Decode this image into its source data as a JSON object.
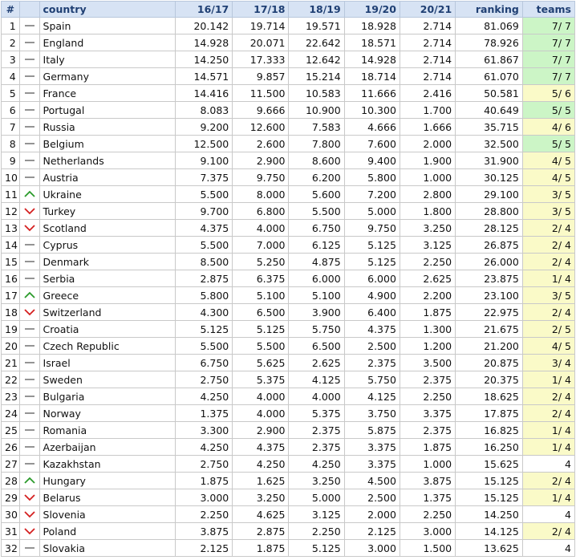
{
  "header": {
    "rank": "#",
    "country": "country",
    "seasons": [
      "16/17",
      "17/18",
      "18/19",
      "19/20",
      "20/21"
    ],
    "ranking": "ranking",
    "teams": "teams"
  },
  "colors": {
    "up": "#2a9a2a",
    "down": "#d42020",
    "same": "#888888",
    "teams_green": "#ccf5c6",
    "teams_yellow": "#fafac8"
  },
  "rows": [
    {
      "rank": "1",
      "trend": "same",
      "country": "Spain",
      "s": [
        "20.142",
        "19.714",
        "19.571",
        "18.928",
        "2.714"
      ],
      "ranking": "81.069",
      "teams": "7/ 7",
      "tc": "green"
    },
    {
      "rank": "2",
      "trend": "same",
      "country": "England",
      "s": [
        "14.928",
        "20.071",
        "22.642",
        "18.571",
        "2.714"
      ],
      "ranking": "78.926",
      "teams": "7/ 7",
      "tc": "green"
    },
    {
      "rank": "3",
      "trend": "same",
      "country": "Italy",
      "s": [
        "14.250",
        "17.333",
        "12.642",
        "14.928",
        "2.714"
      ],
      "ranking": "61.867",
      "teams": "7/ 7",
      "tc": "green"
    },
    {
      "rank": "4",
      "trend": "same",
      "country": "Germany",
      "s": [
        "14.571",
        "9.857",
        "15.214",
        "18.714",
        "2.714"
      ],
      "ranking": "61.070",
      "teams": "7/ 7",
      "tc": "green"
    },
    {
      "rank": "5",
      "trend": "same",
      "country": "France",
      "s": [
        "14.416",
        "11.500",
        "10.583",
        "11.666",
        "2.416"
      ],
      "ranking": "50.581",
      "teams": "5/ 6",
      "tc": "yellow"
    },
    {
      "rank": "6",
      "trend": "same",
      "country": "Portugal",
      "s": [
        "8.083",
        "9.666",
        "10.900",
        "10.300",
        "1.700"
      ],
      "ranking": "40.649",
      "teams": "5/ 5",
      "tc": "green"
    },
    {
      "rank": "7",
      "trend": "same",
      "country": "Russia",
      "s": [
        "9.200",
        "12.600",
        "7.583",
        "4.666",
        "1.666"
      ],
      "ranking": "35.715",
      "teams": "4/ 6",
      "tc": "yellow"
    },
    {
      "rank": "8",
      "trend": "same",
      "country": "Belgium",
      "s": [
        "12.500",
        "2.600",
        "7.800",
        "7.600",
        "2.000"
      ],
      "ranking": "32.500",
      "teams": "5/ 5",
      "tc": "green"
    },
    {
      "rank": "9",
      "trend": "same",
      "country": "Netherlands",
      "s": [
        "9.100",
        "2.900",
        "8.600",
        "9.400",
        "1.900"
      ],
      "ranking": "31.900",
      "teams": "4/ 5",
      "tc": "yellow"
    },
    {
      "rank": "10",
      "trend": "same",
      "country": "Austria",
      "s": [
        "7.375",
        "9.750",
        "6.200",
        "5.800",
        "1.000"
      ],
      "ranking": "30.125",
      "teams": "4/ 5",
      "tc": "yellow"
    },
    {
      "rank": "11",
      "trend": "up",
      "country": "Ukraine",
      "s": [
        "5.500",
        "8.000",
        "5.600",
        "7.200",
        "2.800"
      ],
      "ranking": "29.100",
      "teams": "3/ 5",
      "tc": "yellow"
    },
    {
      "rank": "12",
      "trend": "down",
      "country": "Turkey",
      "s": [
        "9.700",
        "6.800",
        "5.500",
        "5.000",
        "1.800"
      ],
      "ranking": "28.800",
      "teams": "3/ 5",
      "tc": "yellow"
    },
    {
      "rank": "13",
      "trend": "down",
      "country": "Scotland",
      "s": [
        "4.375",
        "4.000",
        "6.750",
        "9.750",
        "3.250"
      ],
      "ranking": "28.125",
      "teams": "2/ 4",
      "tc": "yellow"
    },
    {
      "rank": "14",
      "trend": "same",
      "country": "Cyprus",
      "s": [
        "5.500",
        "7.000",
        "6.125",
        "5.125",
        "3.125"
      ],
      "ranking": "26.875",
      "teams": "2/ 4",
      "tc": "yellow"
    },
    {
      "rank": "15",
      "trend": "same",
      "country": "Denmark",
      "s": [
        "8.500",
        "5.250",
        "4.875",
        "5.125",
        "2.250"
      ],
      "ranking": "26.000",
      "teams": "2/ 4",
      "tc": "yellow"
    },
    {
      "rank": "16",
      "trend": "same",
      "country": "Serbia",
      "s": [
        "2.875",
        "6.375",
        "6.000",
        "6.000",
        "2.625"
      ],
      "ranking": "23.875",
      "teams": "1/ 4",
      "tc": "yellow"
    },
    {
      "rank": "17",
      "trend": "up",
      "country": "Greece",
      "s": [
        "5.800",
        "5.100",
        "5.100",
        "4.900",
        "2.200"
      ],
      "ranking": "23.100",
      "teams": "3/ 5",
      "tc": "yellow"
    },
    {
      "rank": "18",
      "trend": "down",
      "country": "Switzerland",
      "s": [
        "4.300",
        "6.500",
        "3.900",
        "6.400",
        "1.875"
      ],
      "ranking": "22.975",
      "teams": "2/ 4",
      "tc": "yellow"
    },
    {
      "rank": "19",
      "trend": "same",
      "country": "Croatia",
      "s": [
        "5.125",
        "5.125",
        "5.750",
        "4.375",
        "1.300"
      ],
      "ranking": "21.675",
      "teams": "2/ 5",
      "tc": "yellow"
    },
    {
      "rank": "20",
      "trend": "same",
      "country": "Czech Republic",
      "s": [
        "5.500",
        "5.500",
        "6.500",
        "2.500",
        "1.200"
      ],
      "ranking": "21.200",
      "teams": "4/ 5",
      "tc": "yellow"
    },
    {
      "rank": "21",
      "trend": "same",
      "country": "Israel",
      "s": [
        "6.750",
        "5.625",
        "2.625",
        "2.375",
        "3.500"
      ],
      "ranking": "20.875",
      "teams": "3/ 4",
      "tc": "yellow"
    },
    {
      "rank": "22",
      "trend": "same",
      "country": "Sweden",
      "s": [
        "2.750",
        "5.375",
        "4.125",
        "5.750",
        "2.375"
      ],
      "ranking": "20.375",
      "teams": "1/ 4",
      "tc": "yellow"
    },
    {
      "rank": "23",
      "trend": "same",
      "country": "Bulgaria",
      "s": [
        "4.250",
        "4.000",
        "4.000",
        "4.125",
        "2.250"
      ],
      "ranking": "18.625",
      "teams": "2/ 4",
      "tc": "yellow"
    },
    {
      "rank": "24",
      "trend": "same",
      "country": "Norway",
      "s": [
        "1.375",
        "4.000",
        "5.375",
        "3.750",
        "3.375"
      ],
      "ranking": "17.875",
      "teams": "2/ 4",
      "tc": "yellow"
    },
    {
      "rank": "25",
      "trend": "same",
      "country": "Romania",
      "s": [
        "3.300",
        "2.900",
        "2.375",
        "5.875",
        "2.375"
      ],
      "ranking": "16.825",
      "teams": "1/ 4",
      "tc": "yellow"
    },
    {
      "rank": "26",
      "trend": "same",
      "country": "Azerbaijan",
      "s": [
        "4.250",
        "4.375",
        "2.375",
        "3.375",
        "1.875"
      ],
      "ranking": "16.250",
      "teams": "1/ 4",
      "tc": "yellow"
    },
    {
      "rank": "27",
      "trend": "same",
      "country": "Kazakhstan",
      "s": [
        "2.750",
        "4.250",
        "4.250",
        "3.375",
        "1.000"
      ],
      "ranking": "15.625",
      "teams": "4",
      "tc": "white"
    },
    {
      "rank": "28",
      "trend": "up",
      "country": "Hungary",
      "s": [
        "1.875",
        "1.625",
        "3.250",
        "4.500",
        "3.875"
      ],
      "ranking": "15.125",
      "teams": "2/ 4",
      "tc": "yellow"
    },
    {
      "rank": "29",
      "trend": "down",
      "country": "Belarus",
      "s": [
        "3.000",
        "3.250",
        "5.000",
        "2.500",
        "1.375"
      ],
      "ranking": "15.125",
      "teams": "1/ 4",
      "tc": "yellow"
    },
    {
      "rank": "30",
      "trend": "down",
      "country": "Slovenia",
      "s": [
        "2.250",
        "4.625",
        "3.125",
        "2.000",
        "2.250"
      ],
      "ranking": "14.250",
      "teams": "4",
      "tc": "white"
    },
    {
      "rank": "31",
      "trend": "down",
      "country": "Poland",
      "s": [
        "3.875",
        "2.875",
        "2.250",
        "2.125",
        "3.000"
      ],
      "ranking": "14.125",
      "teams": "2/ 4",
      "tc": "yellow"
    },
    {
      "rank": "32",
      "trend": "same",
      "country": "Slovakia",
      "s": [
        "2.125",
        "1.875",
        "5.125",
        "3.000",
        "1.500"
      ],
      "ranking": "13.625",
      "teams": "4",
      "tc": "white"
    }
  ]
}
